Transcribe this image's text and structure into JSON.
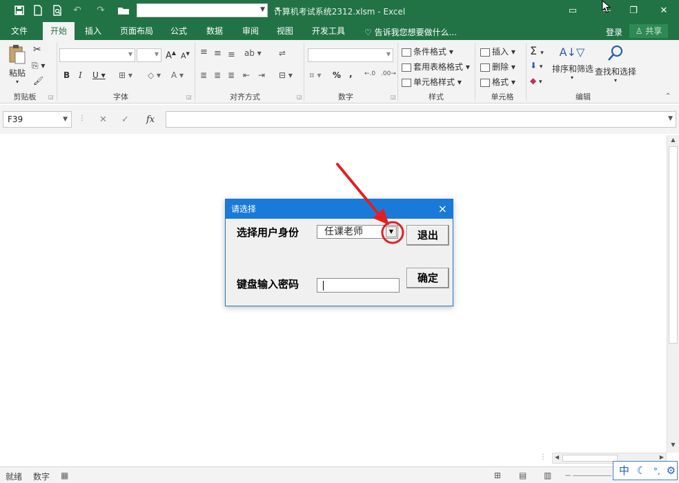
{
  "title_bar": {
    "doc_title": "计算机考试系统2312.xlsm - Excel",
    "qa_icons": [
      "save-icon",
      "new-doc-icon",
      "print-preview-icon",
      "undo-icon",
      "redo-icon",
      "open-folder-icon"
    ],
    "window_buttons": [
      "ribbon-options-icon",
      "minimize-icon",
      "restore-icon",
      "close-icon"
    ]
  },
  "tabs": [
    "文件",
    "开始",
    "插入",
    "页面布局",
    "公式",
    "数据",
    "审阅",
    "视图",
    "开发工具"
  ],
  "active_tab": "开始",
  "tell_me": "告诉我您想要做什么...",
  "login": "登录",
  "share": "共享",
  "ribbon": {
    "groups": {
      "clipboard": "剪贴板",
      "font": "字体",
      "alignment": "对齐方式",
      "number": "数字",
      "styles": "样式",
      "cells": "单元格",
      "editing": "编辑"
    },
    "paste": "粘贴",
    "bold": "B",
    "italic": "I",
    "underline": "U",
    "font_grow": "A",
    "font_shrink": "A",
    "percent": "%",
    "comma": ",",
    "conditional_format": "条件格式",
    "table_format": "套用表格格式",
    "cell_style": "单元格样式",
    "insert": "插入",
    "delete": "删除",
    "format": "格式",
    "sort_filter": "排序和筛选",
    "find_select": "查找和选择"
  },
  "formula_bar": {
    "name_box": "F39",
    "fx": "fx"
  },
  "dialog": {
    "title": "请选择",
    "close": "×",
    "label_role": "选择用户身份",
    "role_value": "任课老师",
    "label_password": "键盘输入密码",
    "exit_button": "退出",
    "ok_button": "确定"
  },
  "status_bar": {
    "ready": "就绪",
    "mode": "数字"
  },
  "ime": {
    "lang": "中"
  },
  "colors": {
    "excel_green": "#217346",
    "dialog_blue": "#1a7ad9",
    "annotation_red": "#e02020"
  }
}
